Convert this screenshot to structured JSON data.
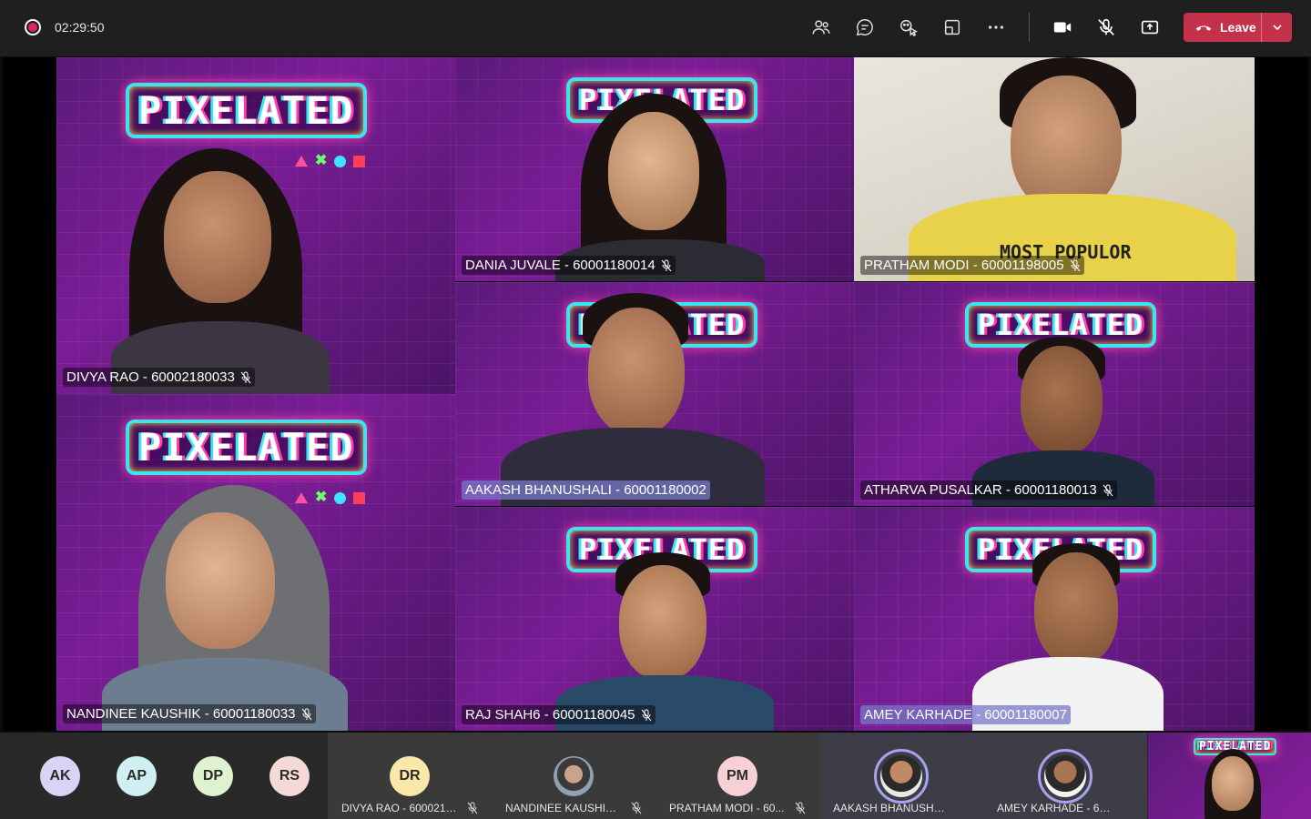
{
  "meeting": {
    "timer": "02:29:50"
  },
  "toolbar": {
    "icons": [
      "people-icon",
      "chat-icon",
      "react-icon",
      "view-icon",
      "more-icon",
      "camera-icon",
      "mic-off-icon",
      "share-icon"
    ],
    "leave_label": "Leave"
  },
  "tiles": [
    {
      "name": "DIVYA RAO - 60002180033",
      "logo": "PIXELATED",
      "muted": true
    },
    {
      "name": "DANIA JUVALE - 60001180014",
      "logo": "PIXELATED",
      "muted": true
    },
    {
      "name": "PRATHAM MODI - 60001198005",
      "muted": true,
      "shirt_text": "MOST POPULOR"
    },
    {
      "name": "AAKASH BHANUSHALI - 60001180002",
      "logo": "PIXELATED",
      "muted": false,
      "speaking": true
    },
    {
      "name": "ATHARVA PUSALKAR - 60001180013",
      "logo": "PIXELATED",
      "muted": true
    },
    {
      "name": "NANDINEE KAUSHIK - 60001180033",
      "logo": "PIXELATED",
      "muted": true
    },
    {
      "name": "RAJ SHAH6 - 60001180045",
      "logo": "PIXELATED",
      "muted": true
    },
    {
      "name": "AMEY KARHADE - 60001180007",
      "logo": "PIXELATED",
      "muted": false,
      "speaking": true
    }
  ],
  "strip": {
    "initials": [
      {
        "initials": "AK",
        "color": "#d9d3f5"
      },
      {
        "initials": "AP",
        "color": "#cfeff3"
      },
      {
        "initials": "DP",
        "color": "#dff2cf"
      },
      {
        "initials": "RS",
        "color": "#f5d9d6"
      }
    ],
    "participants": [
      {
        "name": "DIVYA RAO - 6000218...",
        "initials": "DR",
        "color": "#fbe7a8",
        "muted": true
      },
      {
        "name": "NANDINEE KAUSHIK -...",
        "initials": "",
        "color": "#7a8a9a",
        "muted": true
      },
      {
        "name": "PRATHAM MODI - 60...",
        "initials": "PM",
        "color": "#f7d0d6",
        "muted": true
      },
      {
        "name": "AAKASH BHANUSHALI - 6...",
        "initials": "",
        "color": "",
        "muted": false
      },
      {
        "name": "AMEY KARHADE - 600011...",
        "initials": "",
        "color": "",
        "muted": false
      }
    ],
    "self_logo": "PIXELATED"
  }
}
